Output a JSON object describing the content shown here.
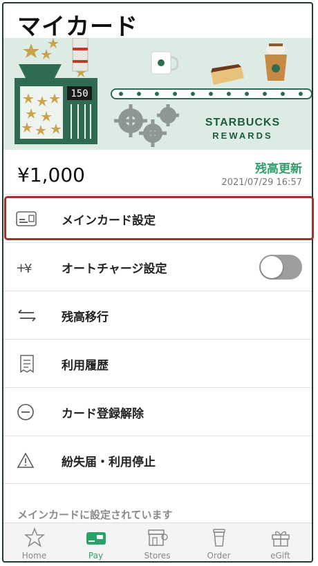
{
  "page": {
    "title": "マイカード"
  },
  "banner": {
    "counter": "150",
    "brand": "STARBUCKS",
    "brand_sub": "REWARDS"
  },
  "balance": {
    "amount": "¥1,000",
    "refresh_label": "残高更新",
    "updated_at": "2021/07/29 16:57"
  },
  "menu": [
    {
      "label": "メインカード設定",
      "icon": "card-icon"
    },
    {
      "label": "オートチャージ設定",
      "icon": "plus-yen-icon",
      "toggle": false
    },
    {
      "label": "残高移行",
      "icon": "transfer-arrows-icon"
    },
    {
      "label": "利用履歴",
      "icon": "receipt-icon"
    },
    {
      "label": "カード登録解除",
      "icon": "minus-circle-icon"
    },
    {
      "label": "紛失届・利用停止",
      "icon": "warning-icon"
    }
  ],
  "footer_note": "メインカードに設定されています",
  "tabs": [
    {
      "label": "Home",
      "icon": "star-icon"
    },
    {
      "label": "Pay",
      "icon": "pay-card-icon",
      "active": true
    },
    {
      "label": "Stores",
      "icon": "store-icon"
    },
    {
      "label": "Order",
      "icon": "cup-icon"
    },
    {
      "label": "eGift",
      "icon": "gift-icon"
    }
  ],
  "colors": {
    "accent": "#2aa36b",
    "refresh": "#2f9e6d",
    "highlight": "#a0322e",
    "banner_bg": "#dcebe4"
  }
}
